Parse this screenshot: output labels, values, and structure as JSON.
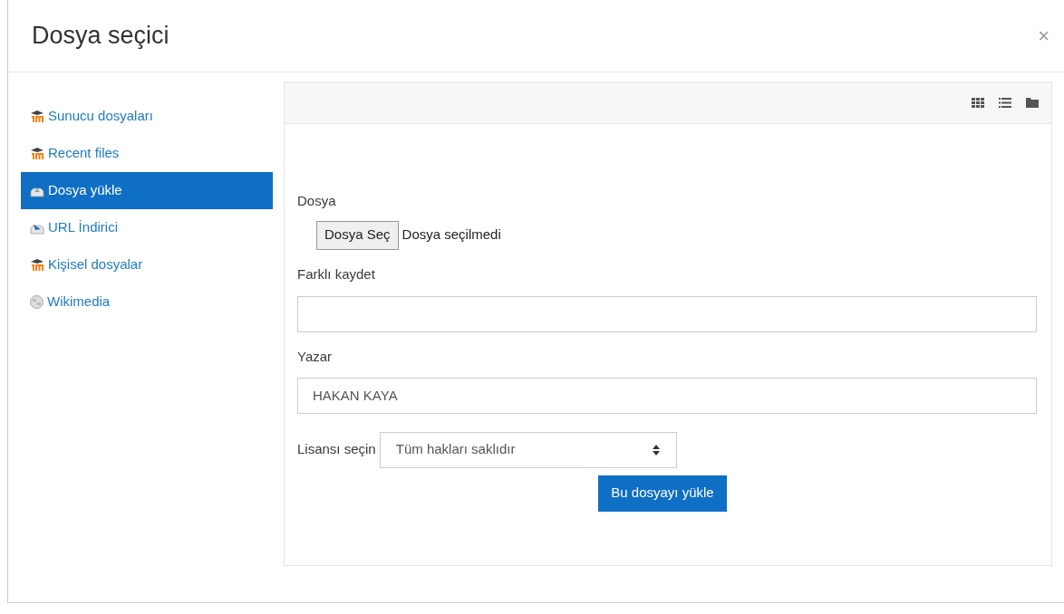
{
  "dialog": {
    "title": "Dosya seçici",
    "close": "×"
  },
  "sidebar": {
    "items": [
      {
        "label": "Sunucu dosyaları",
        "kind": "moodle",
        "selected": false
      },
      {
        "label": "Recent files",
        "kind": "moodle",
        "selected": false
      },
      {
        "label": "Dosya yükle",
        "kind": "upload",
        "selected": true
      },
      {
        "label": "URL İndirici",
        "kind": "url",
        "selected": false
      },
      {
        "label": "Kişisel dosyalar",
        "kind": "moodle",
        "selected": false
      },
      {
        "label": "Wikimedia",
        "kind": "wiki",
        "selected": false
      }
    ]
  },
  "form": {
    "file_label": "Dosya",
    "file_button": "Dosya Seç",
    "file_status": "Dosya seçilmedi",
    "save_as_label": "Farklı kaydet",
    "author_label": "Yazar",
    "author_value": "HAKAN KAYA",
    "license_label": "Lisansı seçin",
    "license_value": "Tüm hakları saklıdır",
    "submit": "Bu dosyayı yükle"
  }
}
